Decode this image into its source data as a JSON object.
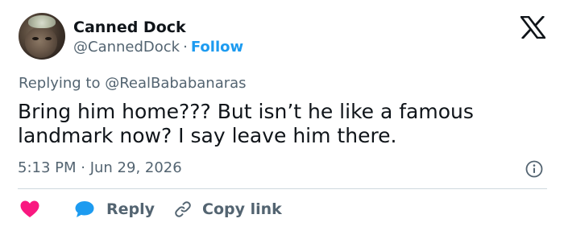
{
  "author": {
    "name": "Canned Dock",
    "handle": "@CannedDock",
    "separator": "·",
    "follow_label": "Follow"
  },
  "brand": {
    "logo_icon": "x-logo-icon"
  },
  "reply_context": {
    "prefix": "Replying to ",
    "target": "@RealBababanaras"
  },
  "tweet": {
    "text": "Bring him home??? But isn’t he like a famous landmark now? I say leave him there.",
    "time": "5:13 PM",
    "date_separator": " · ",
    "date": "Jun 29, 2026"
  },
  "actions": {
    "like_icon": "heart-icon",
    "reply_label": "Reply",
    "reply_icon": "speech-bubble-icon",
    "copy_label": "Copy link",
    "copy_icon": "link-icon"
  },
  "colors": {
    "accent": "#1d9bf0",
    "like": "#f91880",
    "text": "#0f1419",
    "muted": "#536471",
    "divider": "#cfd9de"
  }
}
